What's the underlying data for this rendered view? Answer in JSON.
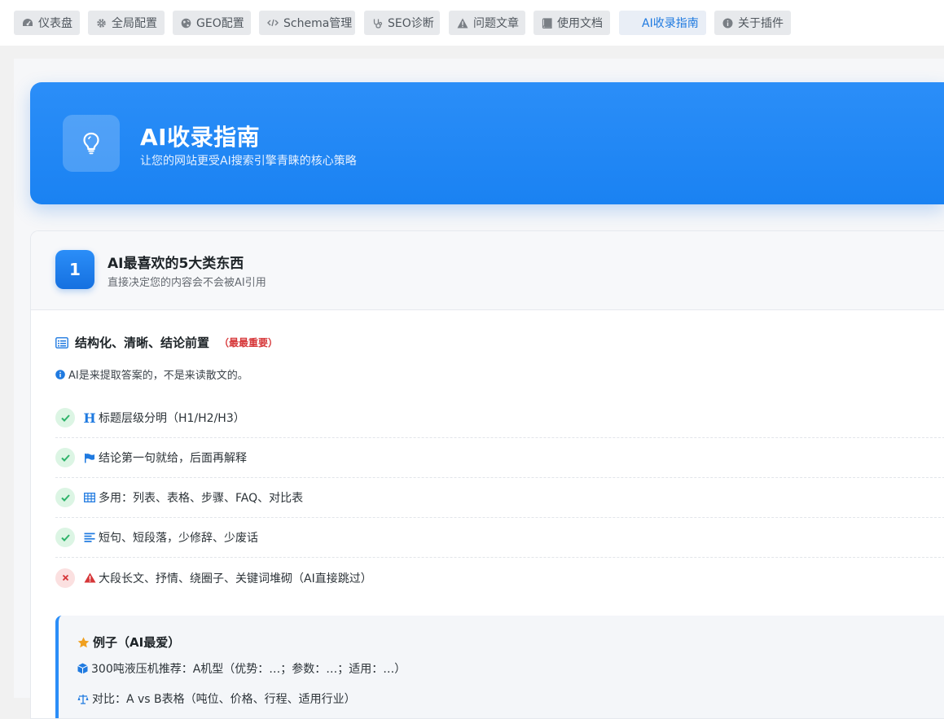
{
  "tabs": [
    {
      "label": "仪表盘",
      "icon": "dashboard-icon"
    },
    {
      "label": "全局配置",
      "icon": "gear-icon"
    },
    {
      "label": "GEO配置",
      "icon": "globe-icon"
    },
    {
      "label": "Schema管理",
      "icon": "code-icon"
    },
    {
      "label": "SEO诊断",
      "icon": "stethoscope-icon"
    },
    {
      "label": "问题文章",
      "icon": "warning-icon"
    },
    {
      "label": "使用文档",
      "icon": "book-icon"
    },
    {
      "label": "AI收录指南",
      "icon": "lightbulb-icon",
      "active": true
    },
    {
      "label": "关于插件",
      "icon": "info-icon"
    }
  ],
  "hero": {
    "title": "AI收录指南",
    "subtitle": "让您的网站更受AI搜索引擎青睐的核心策略",
    "icon": "lightbulb-icon"
  },
  "section1": {
    "number": "1",
    "title": "AI最喜欢的5大类东西",
    "subtitle": "直接决定您的内容会不会被AI引用",
    "block": {
      "title": "结构化、清晰、结论前置",
      "badge": "（最最重要）",
      "note": "AI是来提取答案的，不是来读散文的。",
      "items": [
        {
          "status": "ok",
          "icon": "heading-icon",
          "text": "标题层级分明（H1/H2/H3）"
        },
        {
          "status": "ok",
          "icon": "flag-icon",
          "text": "结论第一句就给，后面再解释"
        },
        {
          "status": "ok",
          "icon": "table-icon",
          "text": "多用：列表、表格、步骤、FAQ、对比表"
        },
        {
          "status": "ok",
          "icon": "align-left-icon",
          "text": "短句、短段落，少修辞、少废话"
        },
        {
          "status": "bad",
          "icon": "warning-icon",
          "text": "大段长文、抒情、绕圈子、关键词堆砌（AI直接跳过）"
        }
      ],
      "example": {
        "title": "例子（AI最爱）",
        "lines": [
          "300吨液压机推荐：A机型（优势：…；参数：…；适用：…）",
          "对比：A vs B表格（吨位、价格、行程、适用行业）"
        ]
      }
    }
  },
  "colors": {
    "accent": "#1f7ae0",
    "hero_start": "#2b8ef8",
    "ok": "#2fb36b",
    "bad": "#d63638",
    "star": "#f0a020"
  }
}
